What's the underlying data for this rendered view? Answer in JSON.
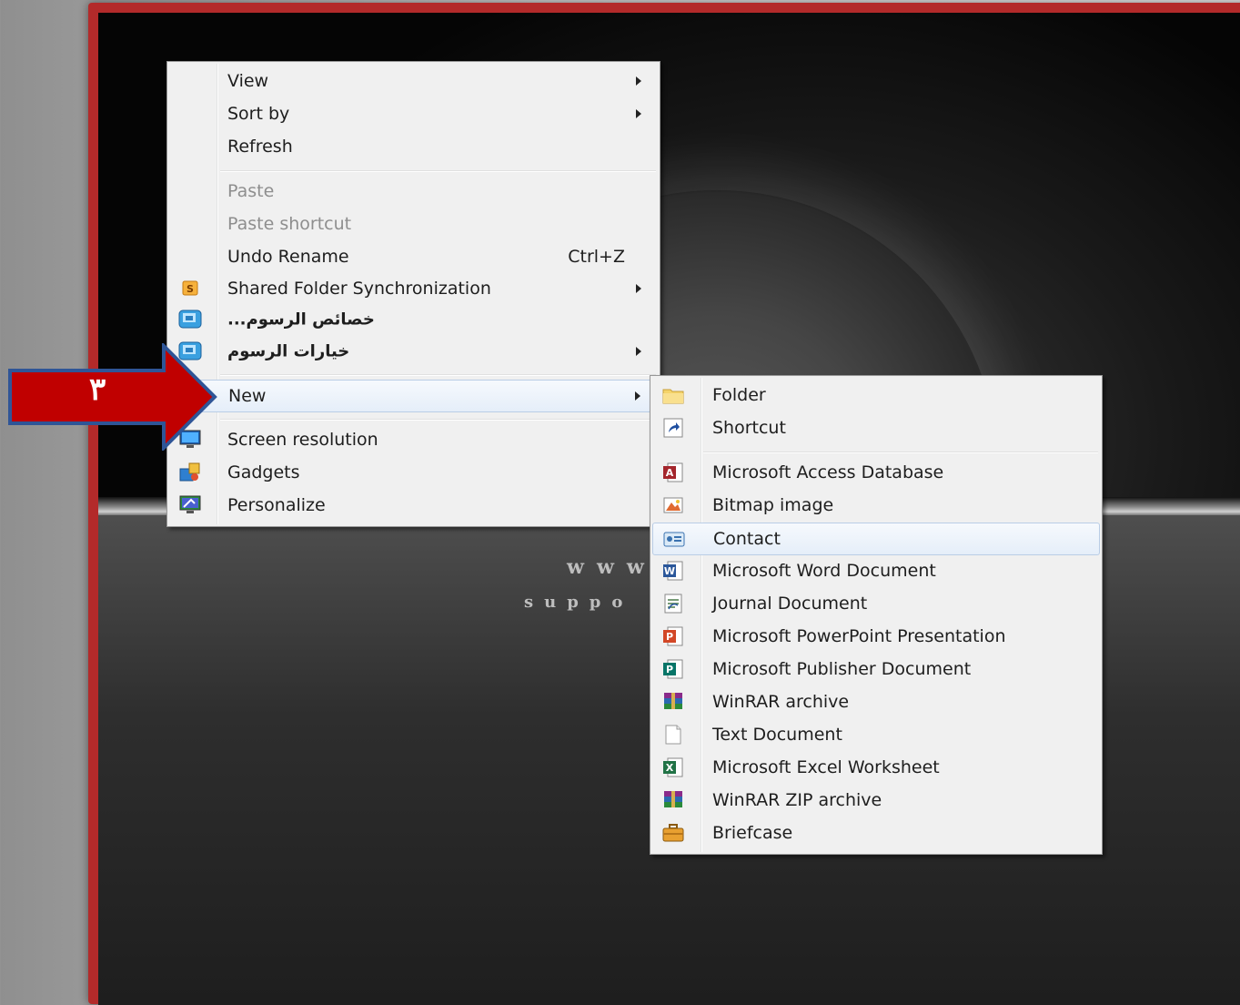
{
  "main_menu": {
    "items": [
      {
        "label": "View",
        "submenu": true,
        "icon": null
      },
      {
        "label": "Sort by",
        "submenu": true,
        "icon": null
      },
      {
        "label": "Refresh",
        "icon": null
      },
      {
        "label": "Paste",
        "disabled": true
      },
      {
        "label": "Paste shortcut",
        "disabled": true
      },
      {
        "label": "Undo Rename",
        "shortcut": "Ctrl+Z"
      },
      {
        "label": "Shared Folder Synchronization",
        "submenu": true,
        "icon": "shared-folder-sync-icon"
      },
      {
        "label": "...خصائص الرسوم",
        "icon": "graphics-properties-icon"
      },
      {
        "label": "خيارات الرسوم",
        "submenu": true,
        "icon": "graphics-options-icon"
      },
      {
        "label": "New",
        "submenu": true,
        "highlighted": true
      },
      {
        "label": "Screen resolution",
        "icon": "screen-resolution-icon"
      },
      {
        "label": "Gadgets",
        "icon": "gadgets-icon"
      },
      {
        "label": "Personalize",
        "icon": "personalize-icon"
      }
    ]
  },
  "sub_menu": {
    "items": [
      {
        "label": "Folder",
        "icon": "folder-icon"
      },
      {
        "label": "Shortcut",
        "icon": "shortcut-icon"
      },
      {
        "label": "Microsoft Access Database",
        "icon": "access-icon"
      },
      {
        "label": "Bitmap image",
        "icon": "bitmap-icon"
      },
      {
        "label": "Contact",
        "icon": "contact-icon",
        "highlighted": true
      },
      {
        "label": "Microsoft Word Document",
        "icon": "word-icon"
      },
      {
        "label": "Journal Document",
        "icon": "journal-icon"
      },
      {
        "label": "Microsoft PowerPoint Presentation",
        "icon": "powerpoint-icon"
      },
      {
        "label": "Microsoft Publisher Document",
        "icon": "publisher-icon"
      },
      {
        "label": "WinRAR archive",
        "icon": "winrar-icon"
      },
      {
        "label": "Text Document",
        "icon": "text-document-icon"
      },
      {
        "label": "Microsoft Excel Worksheet",
        "icon": "excel-icon"
      },
      {
        "label": "WinRAR ZIP archive",
        "icon": "winrar-zip-icon"
      },
      {
        "label": "Briefcase",
        "icon": "briefcase-icon"
      }
    ]
  },
  "desktop": {
    "watermark_line1": "www",
    "watermark_line2": "suppo"
  },
  "callout": {
    "step_number": "٣",
    "color": "#c00000",
    "border_color": "#2f5597"
  }
}
